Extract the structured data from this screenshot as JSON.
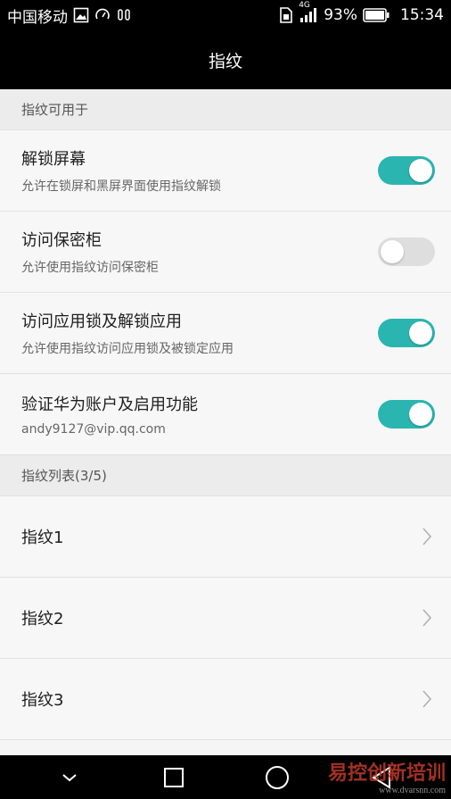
{
  "status_bar": {
    "carrier": "中国移动",
    "network": "4G",
    "battery": "93%",
    "time": "15:34",
    "icons": [
      "image-icon",
      "speed-icon",
      "headset-icon",
      "sim-icon",
      "signal-icon",
      "battery-icon"
    ]
  },
  "title_bar": {
    "title": "指纹"
  },
  "section_usage": {
    "header": "指纹可用于"
  },
  "toggles": [
    {
      "title": "解锁屏幕",
      "subtitle": "允许在锁屏和黑屏界面使用指纹解锁",
      "on": true
    },
    {
      "title": "访问保密柜",
      "subtitle": "允许使用指纹访问保密柜",
      "on": false
    },
    {
      "title": "访问应用锁及解锁应用",
      "subtitle": "允许使用指纹访问应用锁及被锁定应用",
      "on": true
    },
    {
      "title": "验证华为账户及启用功能",
      "subtitle": "andy9127@vip.qq.com",
      "on": true
    }
  ],
  "section_list": {
    "header": "指纹列表(3/5)"
  },
  "fingerprints": [
    {
      "label": "指纹1"
    },
    {
      "label": "指纹2"
    },
    {
      "label": "指纹3"
    }
  ],
  "nav_bar": {
    "icons": [
      "collapse-icon",
      "recents-icon",
      "home-icon",
      "back-icon"
    ]
  },
  "watermark": {
    "text": "易控创新培训",
    "sub": "www.dvarsnn.com"
  },
  "colors": {
    "accent": "#2bb5b0",
    "switch_off": "#dedede",
    "background": "#f5f5f5",
    "bar": "#000000"
  }
}
